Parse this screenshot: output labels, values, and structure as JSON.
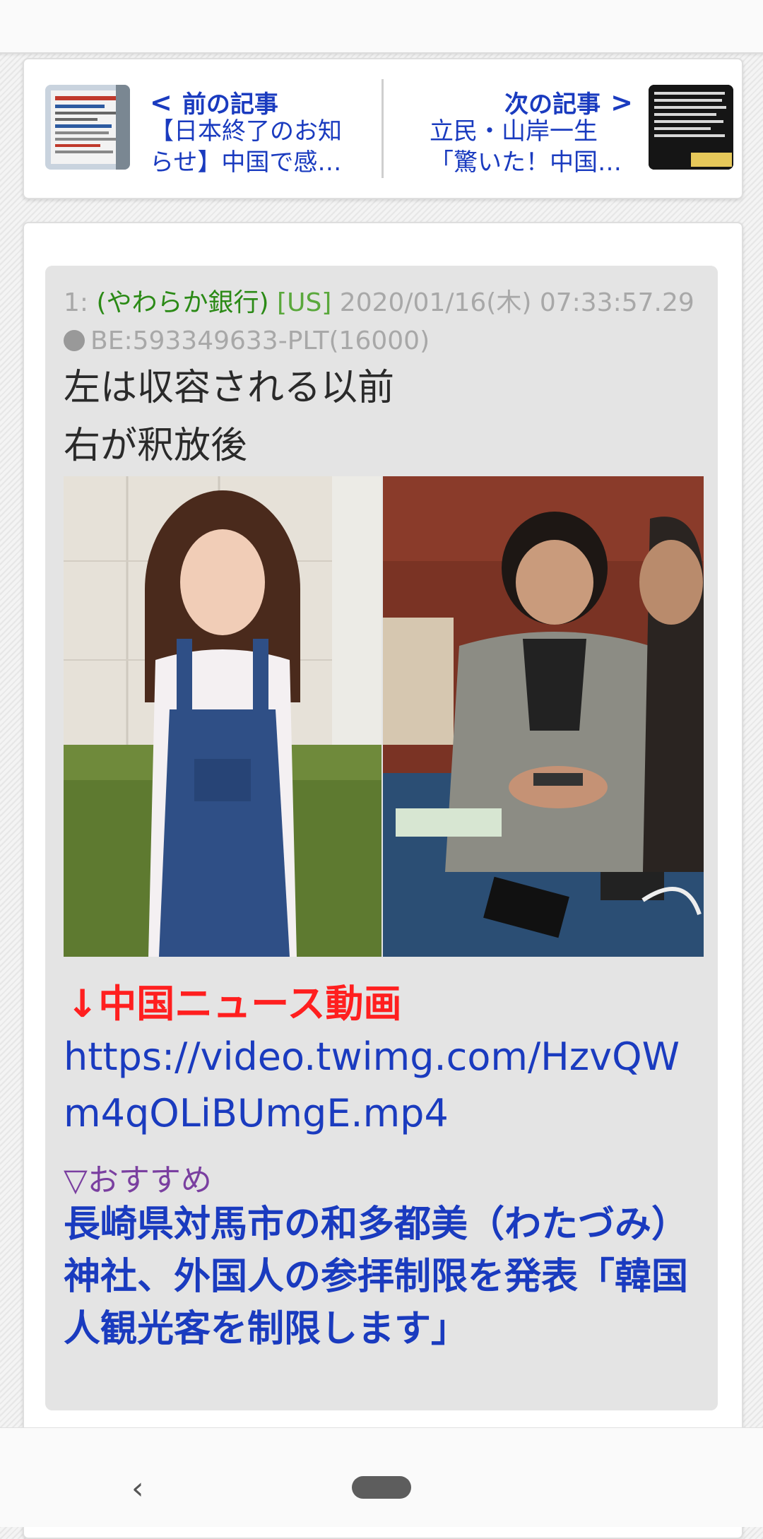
{
  "nav": {
    "prev": {
      "heading": "前の記事",
      "title": "【日本終了のお知らせ】中国で感…",
      "thumb_icon": "notice-board-thumbnail"
    },
    "next": {
      "heading": "次の記事",
      "title": "立民・山岸一生「驚いた！中国…",
      "thumb_icon": "dark-text-thumbnail"
    }
  },
  "post": {
    "number": "1:",
    "name": "(やわらか銀行)",
    "country": "[US]",
    "datetime": "2020/01/16(木) 07:33:57.29",
    "be": "BE:593349633-PLT(16000)",
    "lines": [
      "左は収容される以前",
      "右が釈放後"
    ],
    "image_desc_icon": "photo-comparison",
    "video_heading": "↓中国ニュース動画",
    "video_url": "https://video.twimg.com/HzvQWm4qOLiBUmgE.mp4",
    "recommend_label": "▽おすすめ",
    "recommend_title": "長崎県対馬市の和多都美（わたづみ）神社、外国人の参拝制限を発表「韓国人観光客を制限します」"
  },
  "navbar": {
    "back_glyph": "‹"
  },
  "colors": {
    "link": "#1a3bbf",
    "name": "#2b8a16",
    "red": "#ff1f1f",
    "purple": "#7a3fa0"
  }
}
